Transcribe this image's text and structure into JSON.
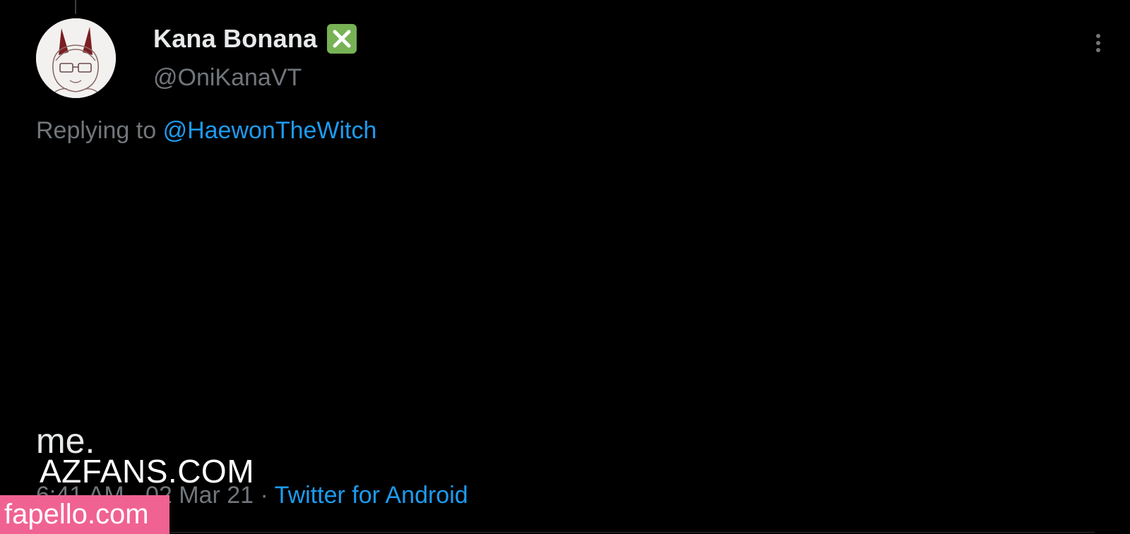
{
  "tweet": {
    "display_name": "Kana Bonana",
    "verified_badge_icon": "cross-mark-button-icon",
    "handle": "@OniKanaVT",
    "replying_prefix": "Replying to",
    "replying_to": "@HaewonTheWitch",
    "text": "me.",
    "timestamp": "6:41 AM · 02 Mar 21",
    "separator": "·",
    "source": "Twitter for Android"
  },
  "watermarks": {
    "azfans": "AZFANS.COM",
    "fapello": "fapello.com"
  },
  "colors": {
    "background": "#000000",
    "primary_text": "#e7e9ea",
    "secondary_text": "#71767b",
    "link": "#1d9bf0",
    "badge": "#77b255",
    "fapello_bg": "#f06292"
  }
}
